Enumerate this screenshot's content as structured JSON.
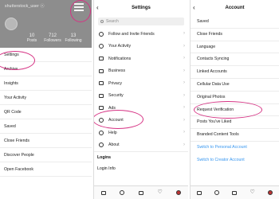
{
  "panel1": {
    "handle": "shutterstock_user ⓥ",
    "stats": [
      {
        "value": "10",
        "label": "Posts"
      },
      {
        "value": "712",
        "label": "Followers"
      },
      {
        "value": "13",
        "label": "Following"
      }
    ],
    "menu": [
      "Settings",
      "Archive",
      "Insights",
      "Your Activity",
      "QR Code",
      "Saved",
      "Close Friends",
      "Discover People",
      "Open Facebook"
    ]
  },
  "panel2": {
    "title": "Settings",
    "search_placeholder": "Search",
    "items": [
      {
        "label": "Follow and Invite Friends",
        "icon": "add-person-icon"
      },
      {
        "label": "Your Activity",
        "icon": "activity-icon"
      },
      {
        "label": "Notifications",
        "icon": "bell-icon"
      },
      {
        "label": "Business",
        "icon": "shop-icon"
      },
      {
        "label": "Privacy",
        "icon": "lock-icon"
      },
      {
        "label": "Security",
        "icon": "shield-icon"
      },
      {
        "label": "Ads",
        "icon": "megaphone-icon"
      },
      {
        "label": "Account",
        "icon": "account-circle-icon"
      },
      {
        "label": "Help",
        "icon": "help-icon"
      },
      {
        "label": "About",
        "icon": "info-icon"
      }
    ],
    "section_logins": "Logins",
    "login_info": "Login Info"
  },
  "panel3": {
    "title": "Account",
    "items": [
      "Saved",
      "Close Friends",
      "Language",
      "Contacts Syncing",
      "Linked Accounts",
      "Cellular Data Use",
      "Original Photos",
      "Request Verification",
      "Posts You've Liked",
      "Branded Content Tools"
    ],
    "links": [
      "Switch to Personal Account",
      "Switch to Creator Account"
    ]
  },
  "tabbar": [
    "home-icon",
    "search-icon",
    "new-post-icon",
    "heart-icon",
    "profile-icon"
  ],
  "colors": {
    "highlight": "#d63384",
    "link": "#3897f0"
  }
}
